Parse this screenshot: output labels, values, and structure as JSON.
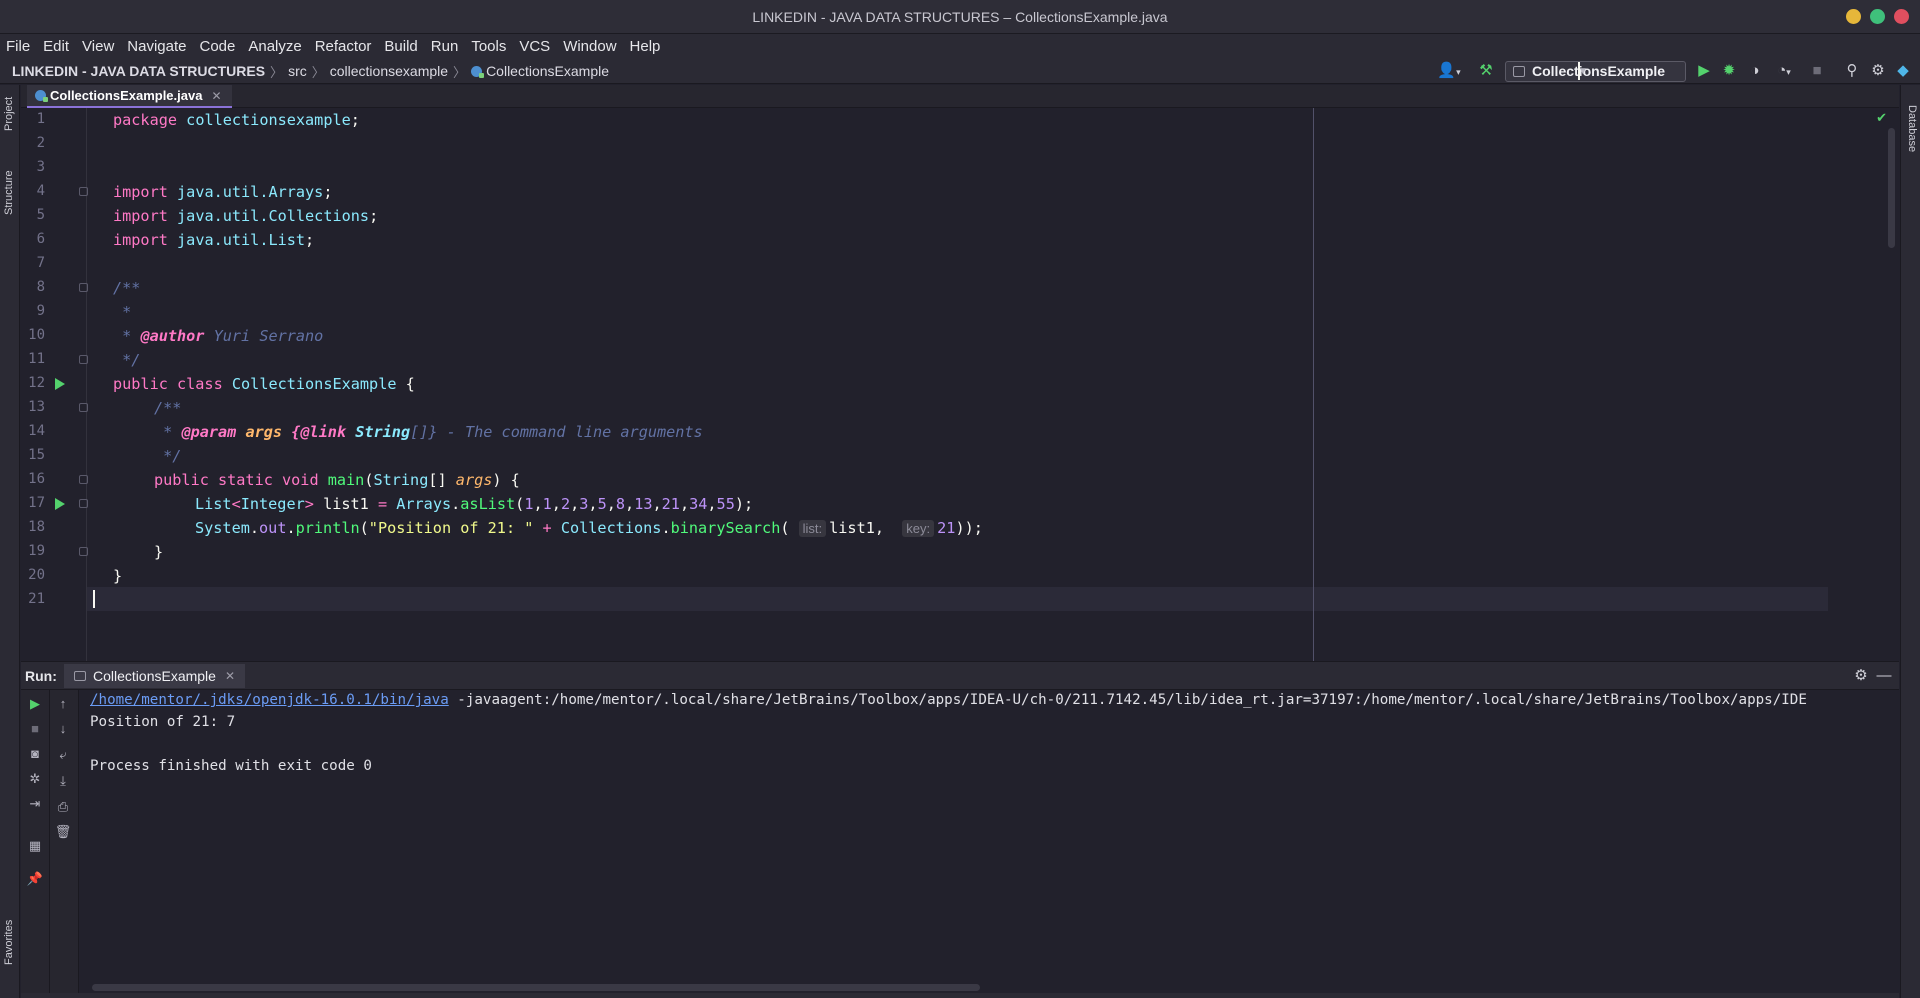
{
  "window": {
    "title": "LINKEDIN - JAVA DATA STRUCTURES – CollectionsExample.java"
  },
  "menu": [
    "File",
    "Edit",
    "View",
    "Navigate",
    "Code",
    "Analyze",
    "Refactor",
    "Build",
    "Run",
    "Tools",
    "VCS",
    "Window",
    "Help"
  ],
  "breadcrumbs": {
    "project": "LINKEDIN - JAVA DATA STRUCTURES",
    "src": "src",
    "package": "collectionsexample",
    "class": "CollectionsExample"
  },
  "run_config": "CollectionsExample",
  "tool_windows": {
    "project": "Project",
    "structure": "Structure",
    "favorites": "Favorites",
    "database": "Database"
  },
  "editor": {
    "tab": "CollectionsExample.java",
    "line_numbers": [
      "1",
      "2",
      "3",
      "4",
      "5",
      "6",
      "7",
      "8",
      "9",
      "10",
      "11",
      "12",
      "13",
      "14",
      "15",
      "16",
      "17",
      "18",
      "19",
      "20",
      "21"
    ],
    "code": {
      "l1_kw": "package",
      "l1_pkg": "collectionsexample",
      "l4_kw": "import",
      "l4_pkg": "java.util.Arrays",
      "l5_kw": "import",
      "l5_pkg": "java.util.Collections",
      "l6_kw": "import",
      "l6_pkg": "java.util.List",
      "l8": "/**",
      "l9": " *",
      "l10_star": " * ",
      "l10_tag": "@author",
      "l10_val": " Yuri Serrano",
      "l11": " */",
      "l12_kw": "public class",
      "l12_cls": "CollectionsExample",
      "l13": "/**",
      "l14_star": " * ",
      "l14_tag": "@param",
      "l14_par": "args",
      "l14_link": "{@link",
      "l14_type": "String",
      "l14_rest": "[]} - The command line arguments",
      "l15": " */",
      "l16_kw": "public static void",
      "l16_fn": "main",
      "l16_type": "String",
      "l16_par": "args",
      "l17_type": "List",
      "l17_gen": "Integer",
      "l17_var": "list1",
      "l17_cls": "Arrays",
      "l17_fn": "asList",
      "l17_nums": [
        "1",
        "1",
        "2",
        "3",
        "5",
        "8",
        "13",
        "21",
        "34",
        "55"
      ],
      "l18_cls": "System",
      "l18_fld": "out",
      "l18_fn": "println",
      "l18_str": "\"Position of 21: \"",
      "l18_cls2": "Collections",
      "l18_fn2": "binarySearch",
      "l18_hint1": "list:",
      "l18_arg1": "list1",
      "l18_hint2": "key:",
      "l18_arg2": "21"
    }
  },
  "run_panel": {
    "label": "Run:",
    "tab": "CollectionsExample",
    "cmd_link": "/home/mentor/.jdks/openjdk-16.0.1/bin/java",
    "cmd_rest": " -javaagent:/home/mentor/.local/share/JetBrains/Toolbox/apps/IDEA-U/ch-0/211.7142.45/lib/idea_rt.jar=37197:/home/mentor/.local/share/JetBrains/Toolbox/apps/IDE",
    "output": "Position of 21: 7",
    "exit": "Process finished with exit code 0"
  },
  "colors": {
    "background": "#22212c",
    "keyword": "#ff79c6",
    "class": "#8be9fd",
    "function": "#50fa7b",
    "string": "#f1fa8c",
    "number": "#bd93f9",
    "comment": "#6272a4",
    "run_green": "#54d26d"
  }
}
